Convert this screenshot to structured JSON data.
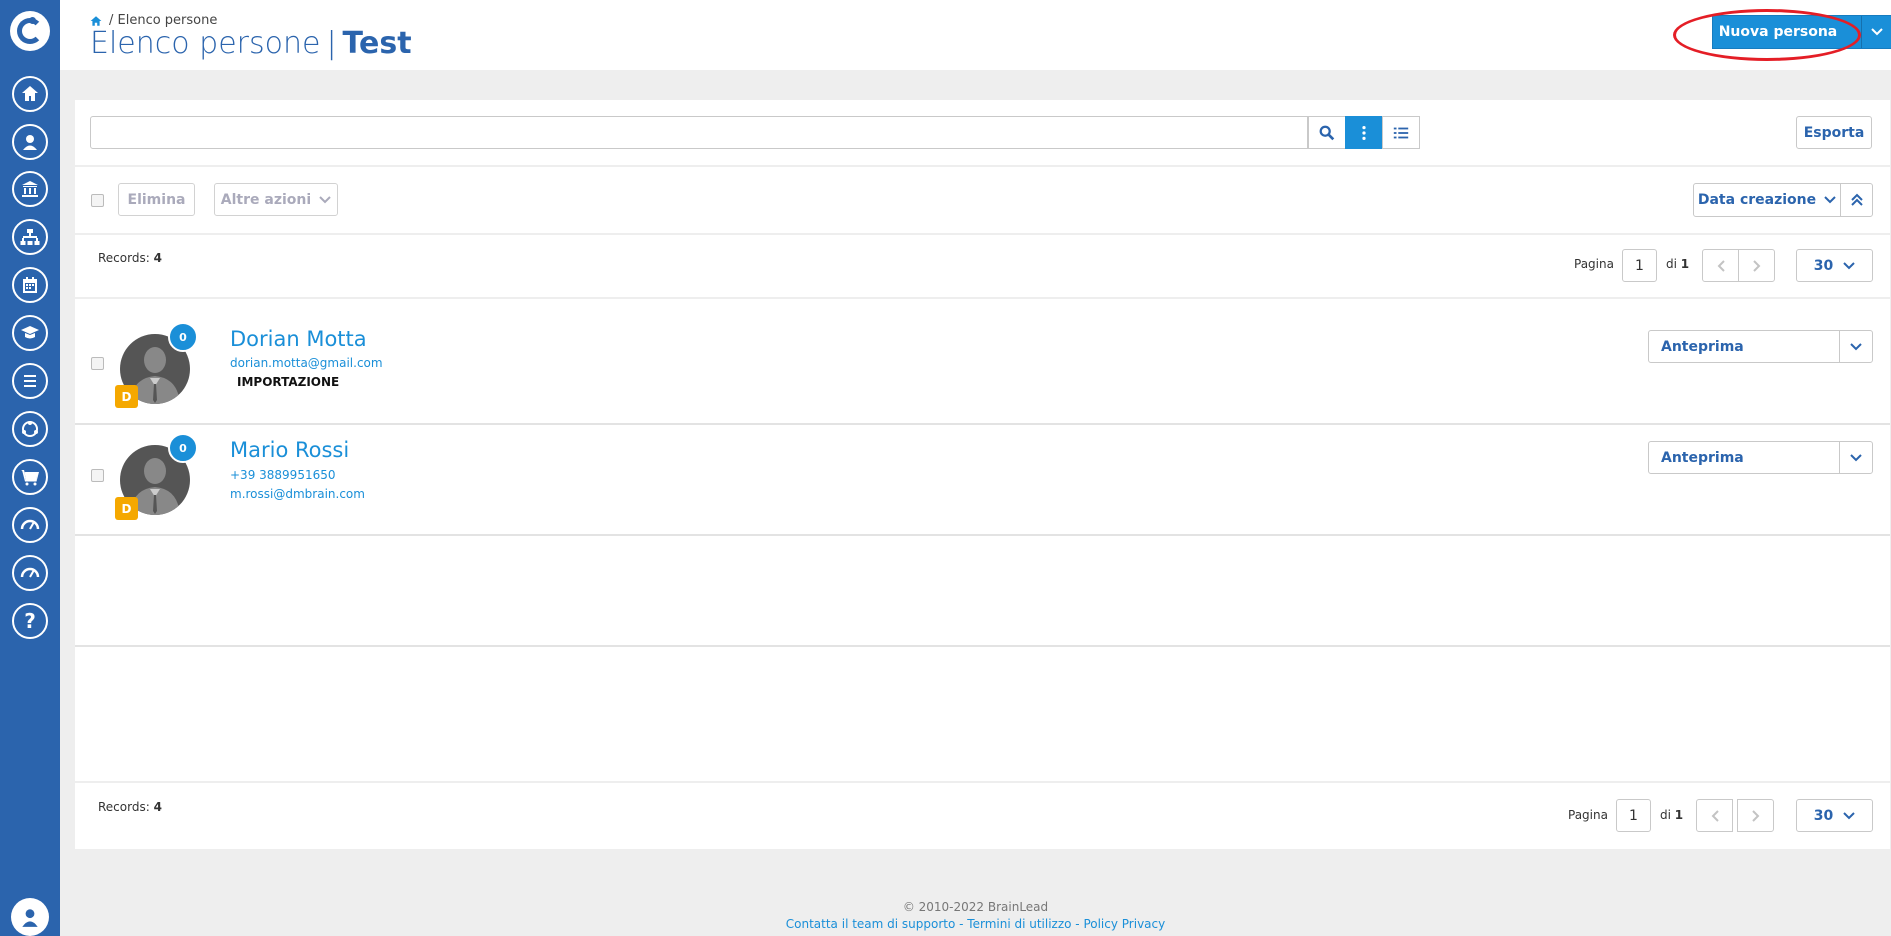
{
  "header": {
    "breadcrumb": "/ Elenco persone",
    "title": "Elenco persone",
    "title_sep": "|",
    "subtitle": "Test",
    "new_button": "Nuova persona"
  },
  "toolbar": {
    "search_value": "",
    "export_label": "Esporta"
  },
  "actions": {
    "delete_label": "Elimina",
    "more_label": "Altre azioni",
    "sort_label": "Data creazione"
  },
  "pagination": {
    "records_label": "Records:",
    "records_count": "4",
    "page_label": "Pagina",
    "page_value": "1",
    "of_label": "di",
    "total_pages": "1",
    "per_page": "30"
  },
  "people": [
    {
      "name": "Dorian Motta",
      "line1": "dorian.motta@gmail.com",
      "tag": "IMPORTAZIONE",
      "badge_count": "0",
      "badge_letter": "D",
      "action_label": "Anteprima"
    },
    {
      "name": "Mario Rossi",
      "line1": "+39 3889951650",
      "line2": "m.rossi@dmbrain.com",
      "badge_count": "0",
      "badge_letter": "D",
      "action_label": "Anteprima"
    }
  ],
  "footer": {
    "copyright": "© 2010-2022 BrainLead",
    "links": "Contatta il team di supporto - Termini di utilizzo - Policy Privacy"
  },
  "icons": [
    "home-icon",
    "user-icon",
    "bank-icon",
    "org-chart-icon",
    "calendar-icon",
    "graduation-icon",
    "list-icon",
    "network-icon",
    "cart-icon",
    "gauge-icon",
    "help-icon",
    "search-icon",
    "dots-icon",
    "list-view-icon"
  ]
}
